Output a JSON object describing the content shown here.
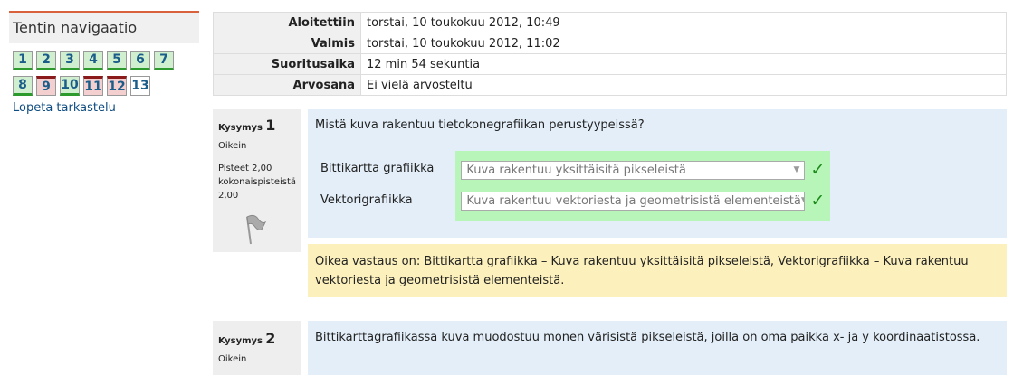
{
  "nav": {
    "title": "Tentin navigaatio",
    "row1": [
      {
        "num": "1",
        "state": "correct"
      },
      {
        "num": "2",
        "state": "correct"
      },
      {
        "num": "3",
        "state": "correct"
      },
      {
        "num": "4",
        "state": "correct"
      },
      {
        "num": "5",
        "state": "correct"
      },
      {
        "num": "6",
        "state": "correct"
      },
      {
        "num": "7",
        "state": "correct"
      }
    ],
    "row2": [
      {
        "num": "8",
        "state": "correct"
      },
      {
        "num": "9",
        "state": "incorrect"
      },
      {
        "num": "10",
        "state": "correct"
      },
      {
        "num": "11",
        "state": "incorrect"
      },
      {
        "num": "12",
        "state": "incorrect"
      },
      {
        "num": "13",
        "state": "ungraded"
      }
    ],
    "finish_link": "Lopeta tarkastelu"
  },
  "summary": {
    "rows": [
      {
        "label": "Aloitettiin",
        "value": "torstai, 10 toukokuu 2012, 10:49"
      },
      {
        "label": "Valmis",
        "value": "torstai, 10 toukokuu 2012, 11:02"
      },
      {
        "label": "Suoritusaika",
        "value": "12 min 54 sekuntia"
      },
      {
        "label": "Arvosana",
        "value": "Ei vielä arvosteltu"
      }
    ]
  },
  "question1": {
    "label": "Kysymys",
    "number": "1",
    "status": "Oikein",
    "points": "Pisteet 2,00 kokonaispisteistä 2,00",
    "text": "Mistä kuva rakentuu tietokonegrafiikan perustyypeissä?",
    "items": [
      {
        "label": "Bittikartta grafiikka",
        "selected": "Kuva rakentuu yksittäisitä pikseleistä"
      },
      {
        "label": "Vektorigrafiikka",
        "selected": "Kuva rakentuu vektoriesta ja geometrisistä elementeistä"
      }
    ],
    "feedback": "Oikea vastaus on: Bittikartta grafiikka – Kuva rakentuu yksittäisitä pikseleistä, Vektorigrafiikka – Kuva rakentuu vektoriesta ja geometrisistä elementeistä."
  },
  "question2": {
    "label": "Kysymys",
    "number": "2",
    "status": "Oikein",
    "text": "Bittikarttagrafiikassa kuva muodostuu monen värisistä pikseleistä, joilla on oma paikka x- ja y koordinaatistossa."
  },
  "colors": {
    "nav_accent": "#d9613b",
    "correct_bg": "#cfefcf",
    "incorrect_bg": "#f4cfcf",
    "question_bg": "#e3eef8",
    "feedback_bg": "#fcf0bc",
    "answer_correct_bg": "#b8f5b8"
  }
}
